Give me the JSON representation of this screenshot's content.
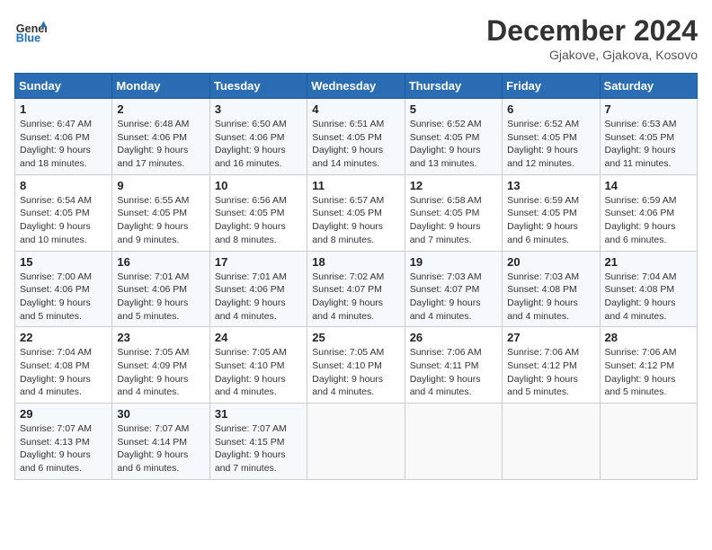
{
  "header": {
    "logo_general": "General",
    "logo_blue": "Blue",
    "month_title": "December 2024",
    "subtitle": "Gjakove, Gjakova, Kosovo"
  },
  "days_of_week": [
    "Sunday",
    "Monday",
    "Tuesday",
    "Wednesday",
    "Thursday",
    "Friday",
    "Saturday"
  ],
  "weeks": [
    [
      {
        "day": "1",
        "sunrise": "6:47 AM",
        "sunset": "4:06 PM",
        "daylight": "9 hours and 18 minutes."
      },
      {
        "day": "2",
        "sunrise": "6:48 AM",
        "sunset": "4:06 PM",
        "daylight": "9 hours and 17 minutes."
      },
      {
        "day": "3",
        "sunrise": "6:50 AM",
        "sunset": "4:06 PM",
        "daylight": "9 hours and 16 minutes."
      },
      {
        "day": "4",
        "sunrise": "6:51 AM",
        "sunset": "4:05 PM",
        "daylight": "9 hours and 14 minutes."
      },
      {
        "day": "5",
        "sunrise": "6:52 AM",
        "sunset": "4:05 PM",
        "daylight": "9 hours and 13 minutes."
      },
      {
        "day": "6",
        "sunrise": "6:52 AM",
        "sunset": "4:05 PM",
        "daylight": "9 hours and 12 minutes."
      },
      {
        "day": "7",
        "sunrise": "6:53 AM",
        "sunset": "4:05 PM",
        "daylight": "9 hours and 11 minutes."
      }
    ],
    [
      {
        "day": "8",
        "sunrise": "6:54 AM",
        "sunset": "4:05 PM",
        "daylight": "9 hours and 10 minutes."
      },
      {
        "day": "9",
        "sunrise": "6:55 AM",
        "sunset": "4:05 PM",
        "daylight": "9 hours and 9 minutes."
      },
      {
        "day": "10",
        "sunrise": "6:56 AM",
        "sunset": "4:05 PM",
        "daylight": "9 hours and 8 minutes."
      },
      {
        "day": "11",
        "sunrise": "6:57 AM",
        "sunset": "4:05 PM",
        "daylight": "9 hours and 8 minutes."
      },
      {
        "day": "12",
        "sunrise": "6:58 AM",
        "sunset": "4:05 PM",
        "daylight": "9 hours and 7 minutes."
      },
      {
        "day": "13",
        "sunrise": "6:59 AM",
        "sunset": "4:05 PM",
        "daylight": "9 hours and 6 minutes."
      },
      {
        "day": "14",
        "sunrise": "6:59 AM",
        "sunset": "4:06 PM",
        "daylight": "9 hours and 6 minutes."
      }
    ],
    [
      {
        "day": "15",
        "sunrise": "7:00 AM",
        "sunset": "4:06 PM",
        "daylight": "9 hours and 5 minutes."
      },
      {
        "day": "16",
        "sunrise": "7:01 AM",
        "sunset": "4:06 PM",
        "daylight": "9 hours and 5 minutes."
      },
      {
        "day": "17",
        "sunrise": "7:01 AM",
        "sunset": "4:06 PM",
        "daylight": "9 hours and 4 minutes."
      },
      {
        "day": "18",
        "sunrise": "7:02 AM",
        "sunset": "4:07 PM",
        "daylight": "9 hours and 4 minutes."
      },
      {
        "day": "19",
        "sunrise": "7:03 AM",
        "sunset": "4:07 PM",
        "daylight": "9 hours and 4 minutes."
      },
      {
        "day": "20",
        "sunrise": "7:03 AM",
        "sunset": "4:08 PM",
        "daylight": "9 hours and 4 minutes."
      },
      {
        "day": "21",
        "sunrise": "7:04 AM",
        "sunset": "4:08 PM",
        "daylight": "9 hours and 4 minutes."
      }
    ],
    [
      {
        "day": "22",
        "sunrise": "7:04 AM",
        "sunset": "4:08 PM",
        "daylight": "9 hours and 4 minutes."
      },
      {
        "day": "23",
        "sunrise": "7:05 AM",
        "sunset": "4:09 PM",
        "daylight": "9 hours and 4 minutes."
      },
      {
        "day": "24",
        "sunrise": "7:05 AM",
        "sunset": "4:10 PM",
        "daylight": "9 hours and 4 minutes."
      },
      {
        "day": "25",
        "sunrise": "7:05 AM",
        "sunset": "4:10 PM",
        "daylight": "9 hours and 4 minutes."
      },
      {
        "day": "26",
        "sunrise": "7:06 AM",
        "sunset": "4:11 PM",
        "daylight": "9 hours and 4 minutes."
      },
      {
        "day": "27",
        "sunrise": "7:06 AM",
        "sunset": "4:12 PM",
        "daylight": "9 hours and 5 minutes."
      },
      {
        "day": "28",
        "sunrise": "7:06 AM",
        "sunset": "4:12 PM",
        "daylight": "9 hours and 5 minutes."
      }
    ],
    [
      {
        "day": "29",
        "sunrise": "7:07 AM",
        "sunset": "4:13 PM",
        "daylight": "9 hours and 6 minutes."
      },
      {
        "day": "30",
        "sunrise": "7:07 AM",
        "sunset": "4:14 PM",
        "daylight": "9 hours and 6 minutes."
      },
      {
        "day": "31",
        "sunrise": "7:07 AM",
        "sunset": "4:15 PM",
        "daylight": "9 hours and 7 minutes."
      },
      null,
      null,
      null,
      null
    ]
  ]
}
